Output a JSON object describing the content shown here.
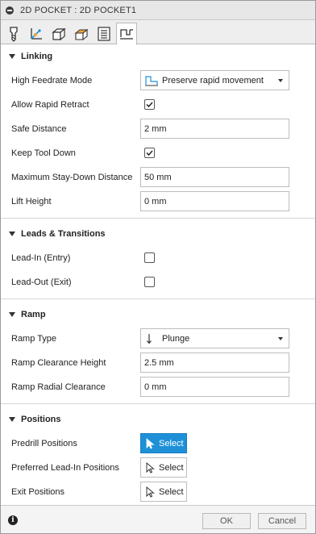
{
  "title": "2D POCKET : 2D POCKET1",
  "tabs": [
    {
      "icon": "tool-icon"
    },
    {
      "icon": "geometry-icon"
    },
    {
      "icon": "heights-icon"
    },
    {
      "icon": "passes-icon"
    },
    {
      "icon": "linking-icon"
    },
    {
      "icon": "linking-tab-icon",
      "active": true
    }
  ],
  "linking": {
    "header": "Linking",
    "high_feedrate_label": "High Feedrate Mode",
    "high_feedrate_value": "Preserve rapid movement",
    "allow_rapid_retract_label": "Allow Rapid Retract",
    "allow_rapid_retract_checked": true,
    "safe_distance_label": "Safe Distance",
    "safe_distance_value": "2 mm",
    "keep_tool_down_label": "Keep Tool Down",
    "keep_tool_down_checked": true,
    "max_stay_down_label": "Maximum Stay-Down Distance",
    "max_stay_down_value": "50 mm",
    "lift_height_label": "Lift Height",
    "lift_height_value": "0 mm"
  },
  "leads": {
    "header": "Leads & Transitions",
    "lead_in_label": "Lead-In (Entry)",
    "lead_in_checked": false,
    "lead_out_label": "Lead-Out (Exit)",
    "lead_out_checked": false
  },
  "ramp": {
    "header": "Ramp",
    "ramp_type_label": "Ramp Type",
    "ramp_type_value": "Plunge",
    "clearance_height_label": "Ramp Clearance Height",
    "clearance_height_value": "2.5 mm",
    "radial_clearance_label": "Ramp Radial Clearance",
    "radial_clearance_value": "0 mm"
  },
  "positions": {
    "header": "Positions",
    "predrill_label": "Predrill Positions",
    "predrill_button": "Select",
    "preferred_lead_in_label": "Preferred Lead-In Positions",
    "preferred_lead_in_button": "Select",
    "exit_label": "Exit Positions",
    "exit_button": "Select"
  },
  "footer": {
    "ok_label": "OK",
    "cancel_label": "Cancel"
  },
  "colors": {
    "accent": "#1e90d8"
  }
}
